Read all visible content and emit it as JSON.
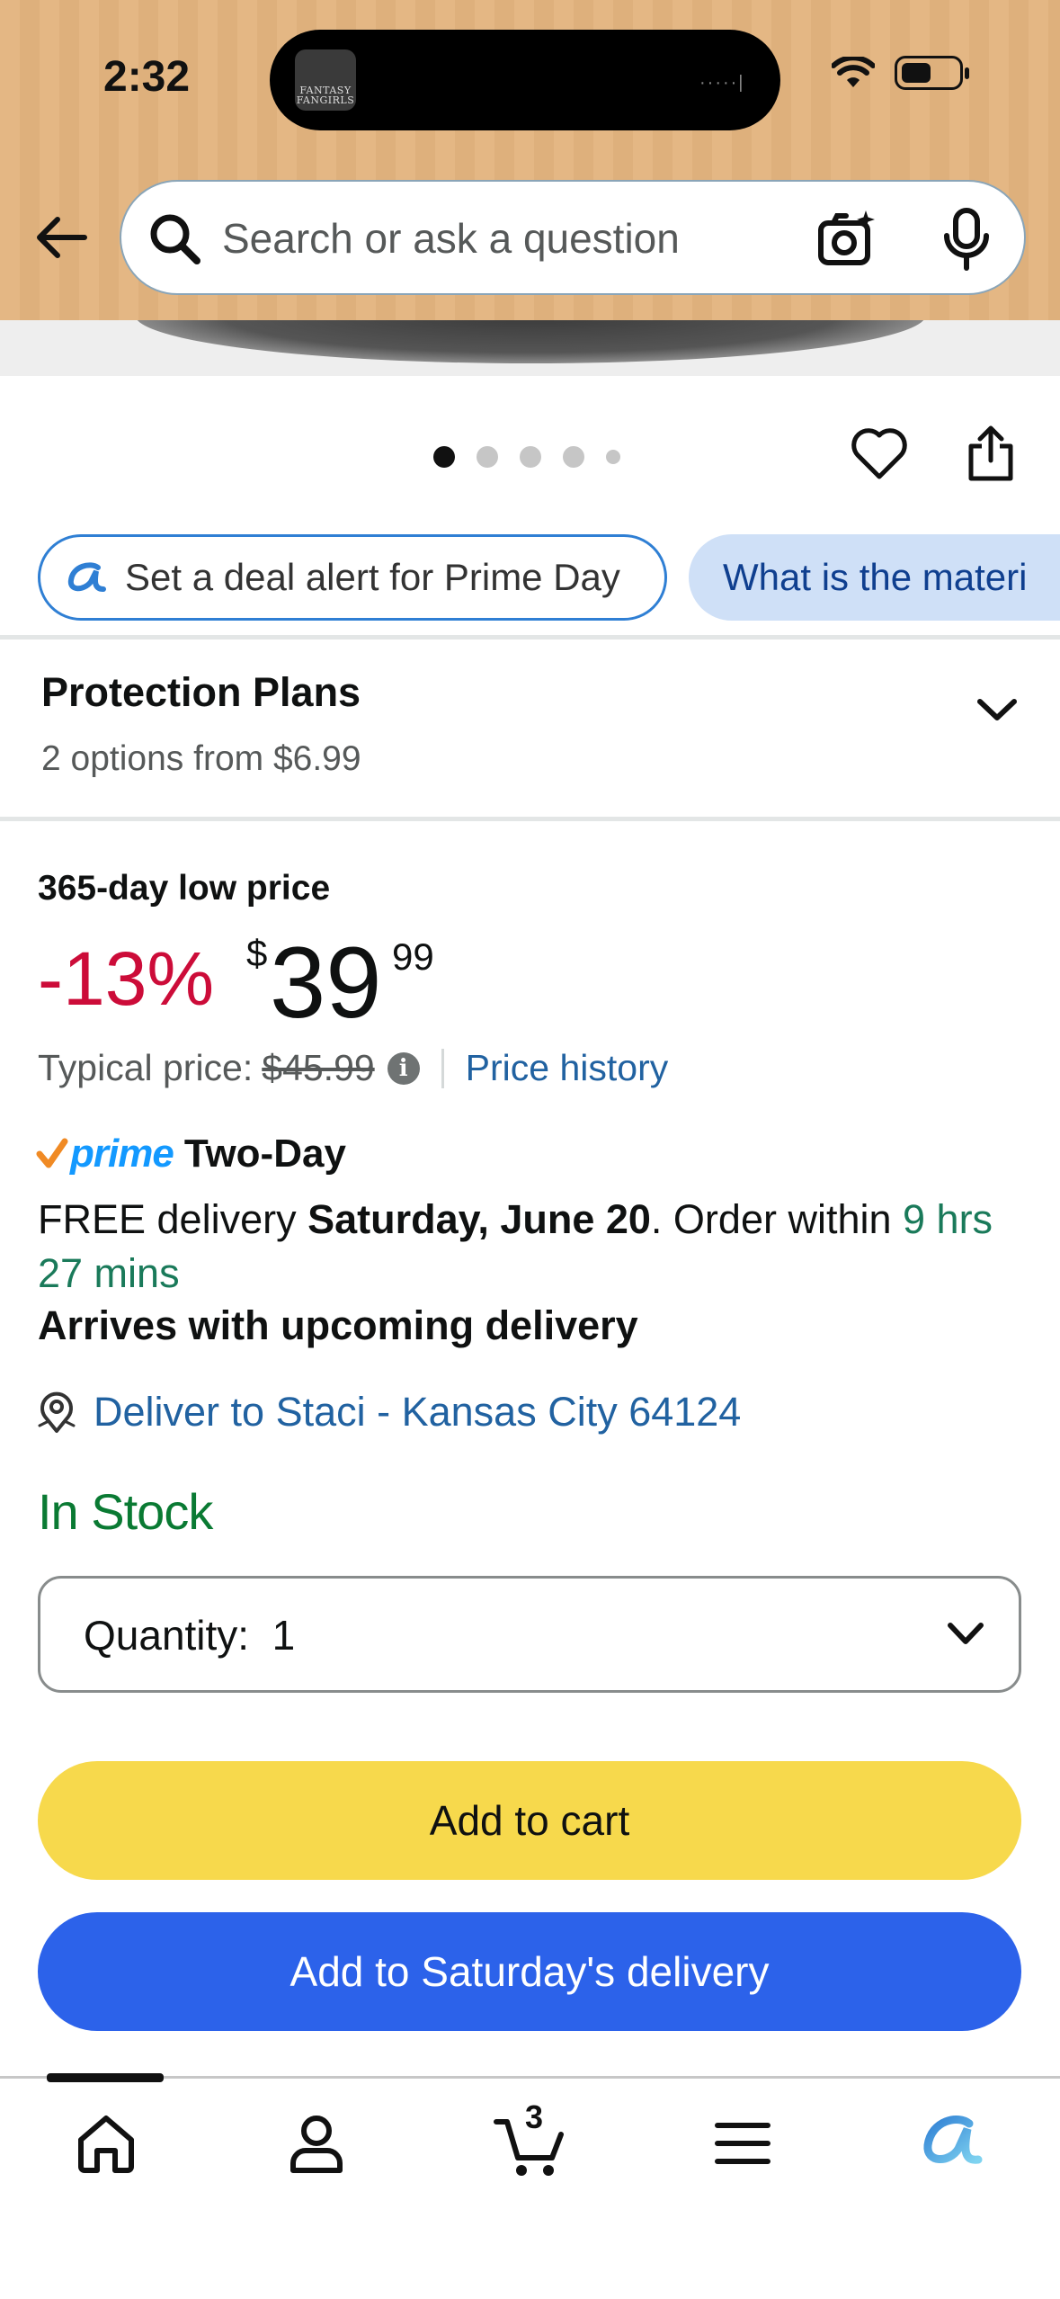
{
  "status_bar": {
    "time": "2:32",
    "island_logo": "FANTASY FANGIRLS"
  },
  "search": {
    "placeholder": "Search or ask a question"
  },
  "carousel": {
    "image_count": 5,
    "active_index": 0
  },
  "chips": {
    "deal_alert": "Set a deal alert for Prime Day",
    "question": "What is the materi"
  },
  "protection_plans": {
    "title": "Protection Plans",
    "subtitle": "2 options from $6.99"
  },
  "price": {
    "low_label": "365-day low price",
    "discount": "-13%",
    "currency_symbol": "$",
    "whole": "39",
    "fraction": "99",
    "typical_label": "Typical price:",
    "typical_value": "$45.99",
    "history_link": "Price history"
  },
  "delivery": {
    "prime_word": "prime",
    "prime_speed": "Two-Day",
    "free_prefix": "FREE delivery ",
    "date": "Saturday, June 20",
    "order_within": ". Order within ",
    "countdown": "9 hrs 27 mins",
    "arrives": "Arrives with upcoming delivery",
    "deliver_to": "Deliver to Staci - Kansas City 64124"
  },
  "stock": {
    "status": "In Stock"
  },
  "quantity": {
    "label": "Quantity:",
    "value": "1"
  },
  "buttons": {
    "add_to_cart": "Add to cart",
    "add_to_delivery": "Add to Saturday's delivery"
  },
  "bottom_nav": {
    "cart_count": "3",
    "items": [
      "home-icon",
      "account-icon",
      "cart-icon",
      "menu-icon",
      "rufus-icon"
    ]
  },
  "colors": {
    "discount_red": "#cc0c39",
    "link_blue": "#2162a1",
    "stock_green": "#0a7a33",
    "cart_yellow": "#f7d94c",
    "delivery_blue": "#2c62ea",
    "prime_blue": "#1399ff"
  }
}
